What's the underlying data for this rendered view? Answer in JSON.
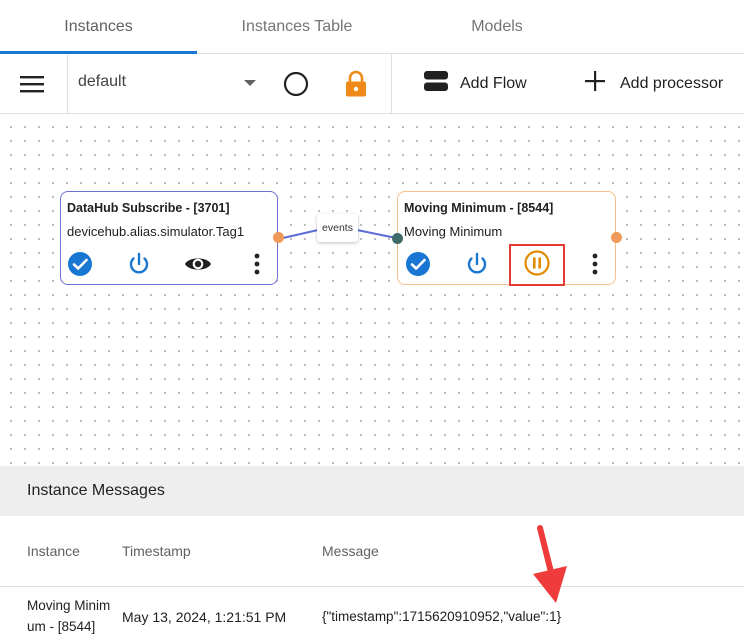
{
  "tabs": [
    {
      "label": "Instances",
      "active": true
    },
    {
      "label": "Instances Table",
      "active": false
    },
    {
      "label": "Models",
      "active": false
    }
  ],
  "toolbar": {
    "flow_select_value": "default",
    "add_flow_label": "Add Flow",
    "add_processor_label": "Add processor",
    "lock_color": "#ef8a1a"
  },
  "nodes": [
    {
      "title": "DataHub Subscribe - [3701]",
      "subtitle": "devicehub.alias.simulator.Tag1",
      "border_color": "#6f6fd6"
    },
    {
      "title": "Moving Minimum - [8544]",
      "subtitle": "Moving Minimum",
      "border_color": "#f4c08a"
    }
  ],
  "edge": {
    "label": "events",
    "color": "#5c6bd6"
  },
  "colors": {
    "accent": "#1976d2",
    "pause": "#e08a00",
    "highlight": "#e53935",
    "port_out": "#ef9a5a",
    "port_in": "#3f6a6a"
  },
  "messages": {
    "title": "Instance Messages",
    "columns": [
      "Instance",
      "Timestamp",
      "Message"
    ],
    "rows": [
      {
        "instance_line1": "Moving Minim",
        "instance_line2": "um - [8544]",
        "timestamp": "May 13, 2024, 1:21:51 PM",
        "message": "{\"timestamp\":1715620910952,\"value\":1}"
      }
    ]
  }
}
